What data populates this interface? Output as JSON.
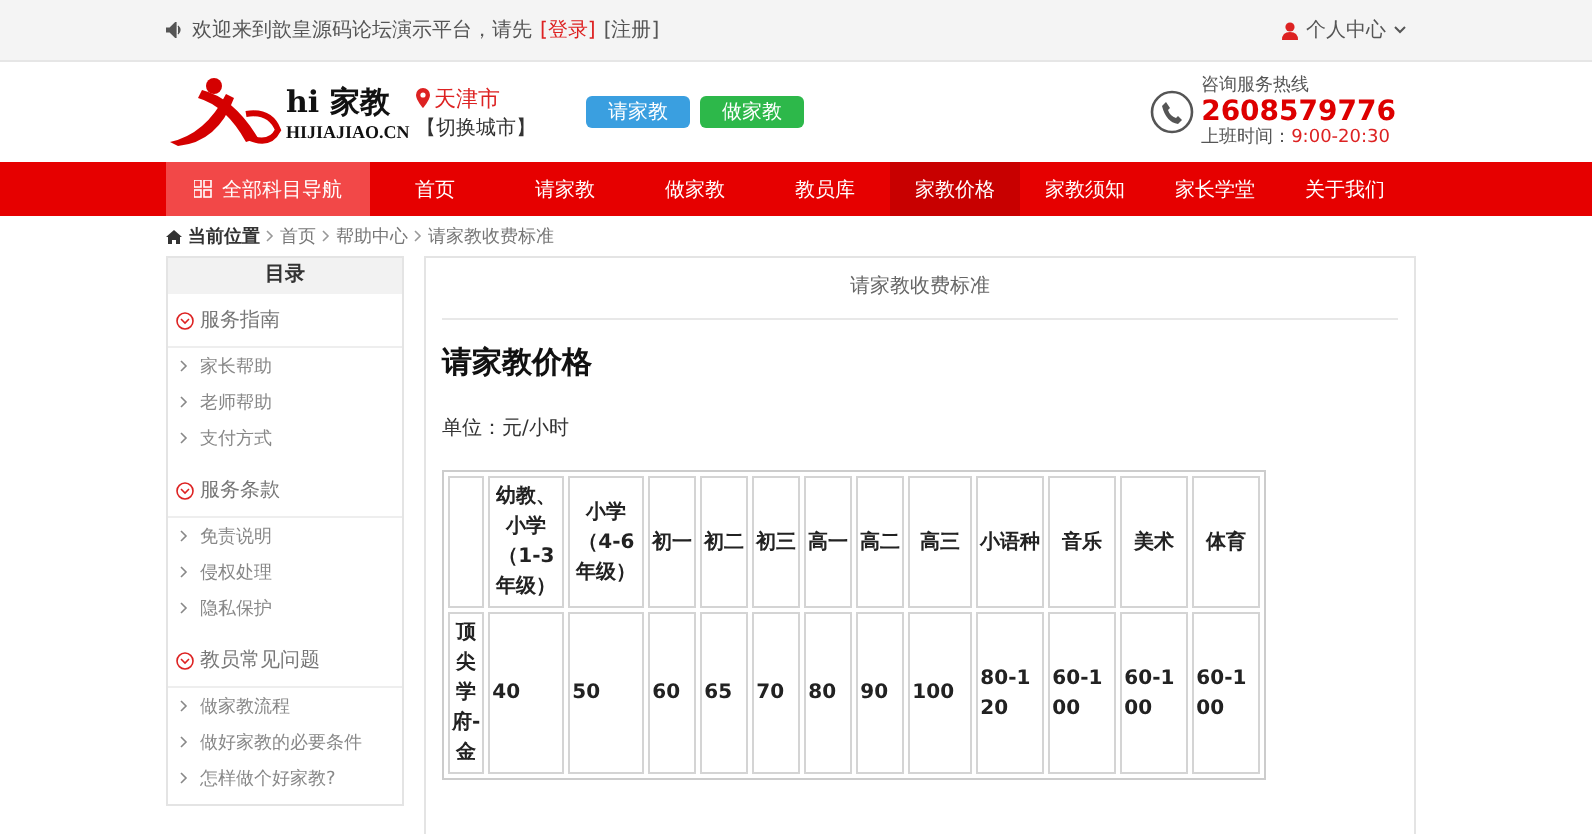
{
  "topbar": {
    "welcome": "欢迎来到歆皇源码论坛演示平台，请先",
    "login": "[登录]",
    "register": "[注册]",
    "user_menu": "个人中心"
  },
  "header": {
    "logo_title": "hi 家教",
    "logo_sub": "HIJIAJIAO.CN",
    "city": "天津市",
    "switch_city": "【切换城市】",
    "buttons": [
      {
        "label": "请家教",
        "kind": "blue"
      },
      {
        "label": "做家教",
        "kind": "green"
      }
    ],
    "hotline_label": "咨询服务热线",
    "hotline": "2608579776",
    "hours_label": "上班时间：",
    "hours": "9:00-20:30"
  },
  "nav": [
    {
      "label": "全部科目导航",
      "kind": "all",
      "selected": false
    },
    {
      "label": "首页",
      "kind": "link",
      "selected": false
    },
    {
      "label": "请家教",
      "kind": "link",
      "selected": false
    },
    {
      "label": "做家教",
      "kind": "link",
      "selected": false
    },
    {
      "label": "教员库",
      "kind": "link",
      "selected": false
    },
    {
      "label": "家教价格",
      "kind": "link",
      "selected": true
    },
    {
      "label": "家教须知",
      "kind": "link",
      "selected": false
    },
    {
      "label": "家长学堂",
      "kind": "link",
      "selected": false
    },
    {
      "label": "关于我们",
      "kind": "link",
      "selected": false
    }
  ],
  "breadcrumb": {
    "label": "当前位置",
    "items": [
      "首页",
      "帮助中心",
      "请家教收费标准"
    ]
  },
  "sidebar": {
    "title": "目录",
    "sections": [
      {
        "title": "服务指南",
        "items": [
          "家长帮助",
          "老师帮助",
          "支付方式"
        ]
      },
      {
        "title": "服务条款",
        "items": [
          "免责说明",
          "侵权处理",
          "隐私保护"
        ]
      },
      {
        "title": "教员常见问题",
        "items": [
          "做家教流程",
          "做好家教的必要条件",
          "怎样做个好家教?"
        ]
      }
    ]
  },
  "content": {
    "page_title": "请家教收费标准",
    "heading": "请家教价格",
    "unit": "单位：元/小时",
    "table": {
      "columns": [
        "幼教、小学（1-3年级）",
        "小学（4-6年级）",
        "初一",
        "初二",
        "初三",
        "高一",
        "高二",
        "高三",
        "小语种",
        "音乐",
        "美术",
        "体育"
      ],
      "rows": [
        {
          "label": "顶尖学府-金",
          "cells": [
            "40",
            "50",
            "60",
            "65",
            "70",
            "80",
            "90",
            "100",
            "80-120",
            "60-100",
            "60-100",
            "60-100"
          ]
        }
      ]
    }
  }
}
